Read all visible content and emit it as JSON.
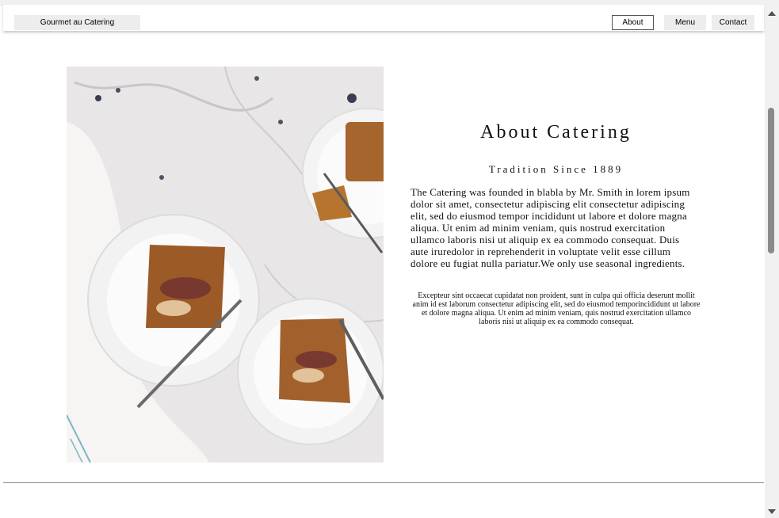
{
  "nav": {
    "brand": "Gourmet au Catering",
    "items": [
      "About",
      "Menu",
      "Contact"
    ]
  },
  "about": {
    "title": "About Catering",
    "subtitle": "Tradition Since 1889",
    "body": "The Catering was founded in blabla by Mr. Smith in lorem ipsum dolor sit amet, consectetur adipiscing elit consectetur adipiscing elit, sed do eiusmod tempor incididunt ut labore et dolore magna aliqua. Ut enim ad minim veniam, quis nostrud exercitation ullamco laboris nisi ut aliquip ex ea commodo consequat. Duis aute iruredolor in reprehenderit in voluptate velit esse cillum dolore eu fugiat nulla pariatur.We only use seasonal ingredients.",
    "small": "Excepteur sint occaecat cupidatat non proident, sunt in culpa qui officia deserunt mollit anim id est laborum consectetur adipiscing elit, sed do eiusmod temporincididunt ut labore et dolore magna aliqua. Ut enim ad minim veniam, quis nostrud exercitation ullamco laboris nisi ut aliquip ex ea commodo consequat."
  },
  "colors": {
    "nav_button_bg": "#ededed",
    "page_bg": "#ffffff",
    "scroll_thumb": "#8a8a8a"
  }
}
